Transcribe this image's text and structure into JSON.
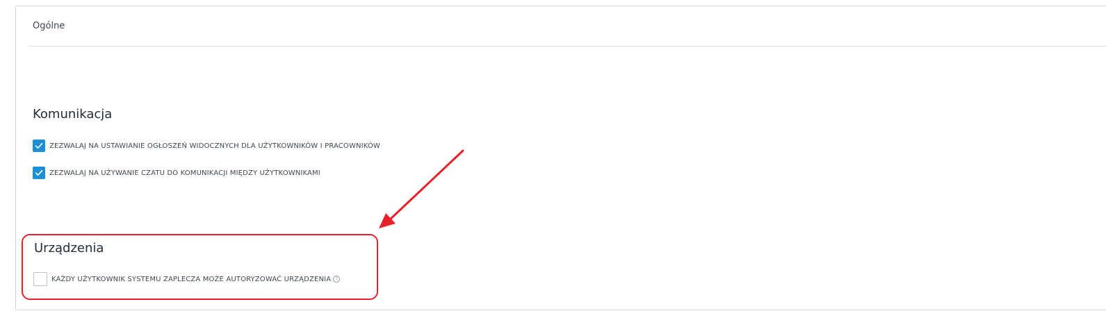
{
  "panel": {
    "title": "Ogólne"
  },
  "communication": {
    "heading": "Komunikacja",
    "options": [
      {
        "label": "ZEZWALAJ NA USTAWIANIE OGŁOSZEŃ WIDOCZNYCH DLA UŻYTKOWNIKÓW I PRACOWNIKÓW",
        "checked": true
      },
      {
        "label": "ZEZWALAJ NA UŻYWANIE CZATU DO KOMUNIKACJI MIĘDZY UŻYTKOWNIKAMI",
        "checked": true
      }
    ]
  },
  "devices": {
    "heading": "Urządzenia",
    "options": [
      {
        "label": "KAŻDY UŻYTKOWNIK SYSTEMU ZAPLECZA MOŻE AUTORYZOWAĆ URZĄDZENIA",
        "checked": false,
        "help_icon": "?"
      }
    ]
  },
  "colors": {
    "checkbox_checked": "#1c8fd6",
    "annotation": "#e8202a"
  }
}
